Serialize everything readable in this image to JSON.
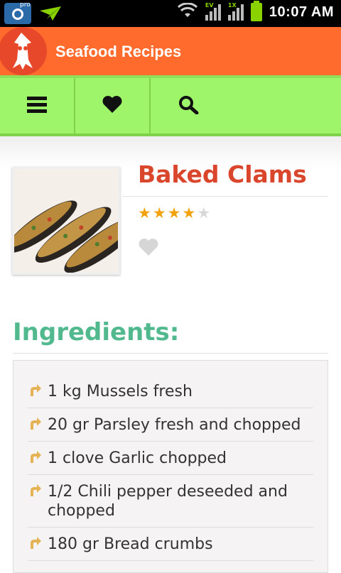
{
  "status_bar": {
    "time": "10:07 AM",
    "camera_badge": "pro",
    "signal_1_label": "EV",
    "signal_2_label": "1X"
  },
  "app": {
    "title": "Seafood Recipes",
    "brand_color": "#ff6b2c",
    "toolbar_color": "#9ff56a"
  },
  "toolbar": {
    "tabs": [
      {
        "icon": "menu-icon"
      },
      {
        "icon": "heart-icon"
      },
      {
        "icon": "search-icon"
      }
    ]
  },
  "recipe": {
    "title": "Baked Clams",
    "title_color": "#d9462c",
    "rating": 4,
    "rating_max": 5,
    "favorite": false
  },
  "ingredients": {
    "heading": "Ingredients:",
    "heading_color": "#52b98f",
    "items": [
      "1 kg Mussels fresh",
      "20 gr Parsley fresh and chopped",
      "1 clove Garlic chopped",
      "1/2 Chili pepper deseeded and chopped",
      "180 gr Bread crumbs"
    ]
  }
}
